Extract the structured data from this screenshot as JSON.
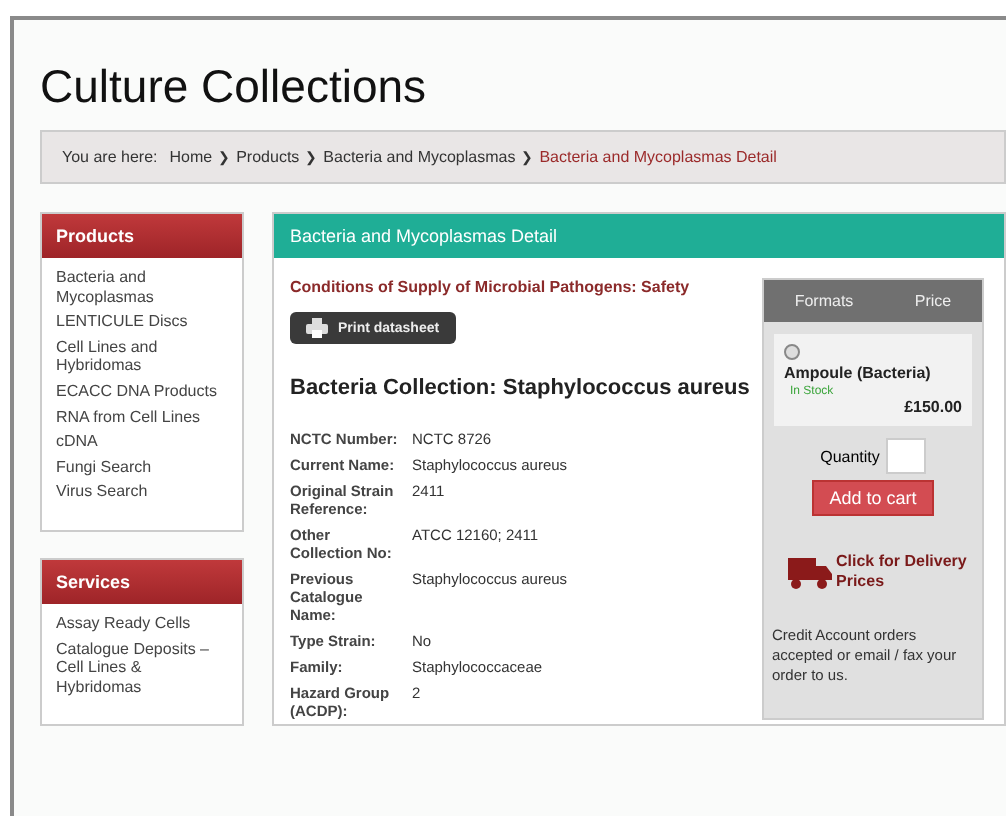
{
  "page_title": "Culture Collections",
  "breadcrumb": {
    "label": "You are here:",
    "items": [
      {
        "text": "Home",
        "current": false
      },
      {
        "text": "Products",
        "current": false
      },
      {
        "text": "Bacteria and Mycoplasmas",
        "current": false
      },
      {
        "text": "Bacteria and Mycoplasmas Detail",
        "current": true
      }
    ],
    "separator": "❯"
  },
  "sidebar": [
    {
      "title": "Products",
      "items": [
        "Bacteria and Mycoplasmas",
        "LENTICULE Discs",
        "Cell Lines and Hybridomas",
        "ECACC DNA Products",
        "RNA from Cell Lines",
        "cDNA",
        "Fungi Search",
        "Virus Search"
      ]
    },
    {
      "title": "Services",
      "items": [
        "Assay Ready Cells",
        "Catalogue Deposits – Cell Lines & Hybridomas"
      ]
    }
  ],
  "panel": {
    "title": "Bacteria and Mycoplasmas Detail",
    "conditions_link": "Conditions of Supply of Microbial Pathogens: Safety",
    "print_button": "Print datasheet",
    "heading": "Bacteria Collection: Staphylococcus aureus",
    "details": [
      {
        "label": "NCTC Number:",
        "value": "NCTC 8726"
      },
      {
        "label": "Current Name:",
        "value": "Staphylococcus aureus"
      },
      {
        "label": "Original Strain Reference:",
        "value": "2411"
      },
      {
        "label": "Other Collection No:",
        "value": "ATCC 12160; 2411"
      },
      {
        "label": "Previous Catalogue Name:",
        "value": "Staphylococcus aureus"
      },
      {
        "label": "Type Strain:",
        "value": "No"
      },
      {
        "label": "Family:",
        "value": "Staphylococcaceae"
      },
      {
        "label": "Hazard Group (ACDP):",
        "value": "2"
      }
    ]
  },
  "order": {
    "columns": [
      "Formats",
      "Price"
    ],
    "formats": [
      {
        "name": "Ampoule (Bacteria)",
        "stock": "In Stock",
        "price": "£150.00",
        "selected": false
      }
    ],
    "quantity_label": "Quantity",
    "add_button": "Add to cart",
    "delivery_link": "Click for Delivery Prices",
    "note": "Credit Account orders accepted or email / fax your order to us."
  }
}
